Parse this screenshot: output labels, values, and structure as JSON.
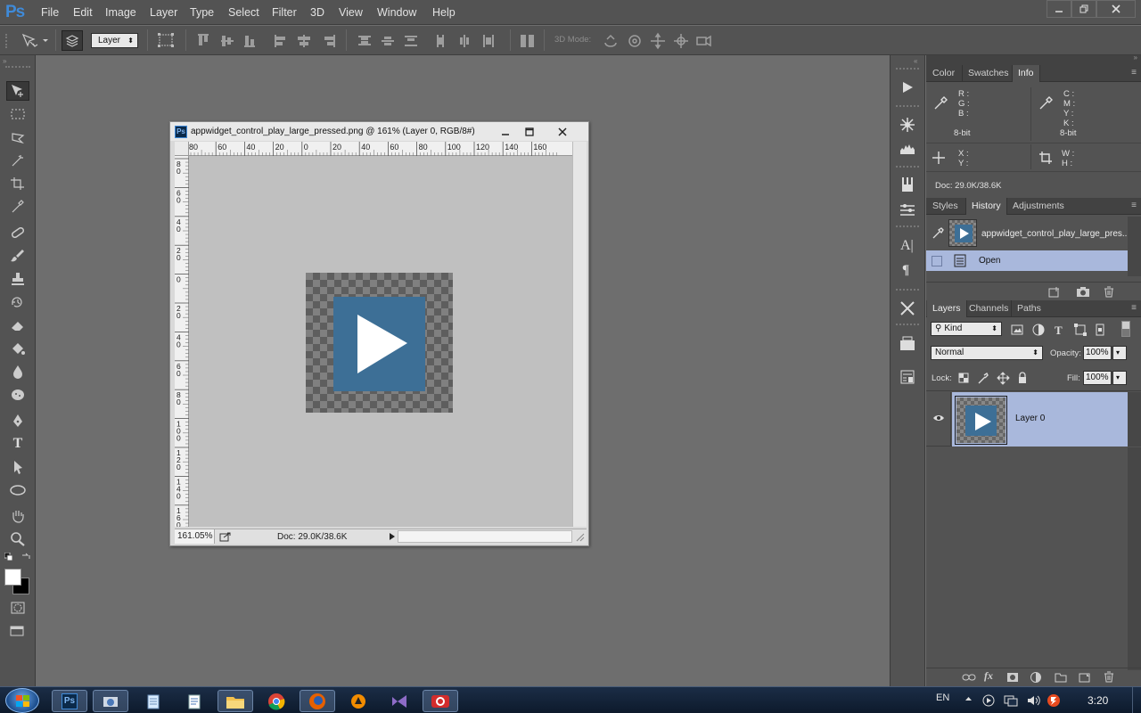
{
  "app": {
    "logo": "Ps"
  },
  "menu": [
    "File",
    "Edit",
    "Image",
    "Layer",
    "Type",
    "Select",
    "Filter",
    "3D",
    "View",
    "Window",
    "Help"
  ],
  "options_bar": {
    "auto_select_value": "Layer",
    "three_d_mode_label": "3D Mode:"
  },
  "document": {
    "title": "appwidget_control_play_large_pressed.png @ 161% (Layer 0, RGB/8#)",
    "ruler_top": [
      "80",
      "60",
      "40",
      "20",
      "0",
      "20",
      "40",
      "60",
      "80",
      "100",
      "120",
      "140",
      "160"
    ],
    "ruler_left": [
      "8\n0",
      "6\n0",
      "4\n0",
      "2\n0",
      "0",
      "2\n0",
      "4\n0",
      "6\n0",
      "8\n0",
      "1\n0\n0",
      "1\n2\n0",
      "1\n4\n0",
      "1\n6\n0"
    ],
    "zoom": "161.05%",
    "doc_size": "Doc: 29.0K/38.6K",
    "image_bg_color": "#3d6f96"
  },
  "info_panel": {
    "tabs": [
      "Color",
      "Swatches",
      "Info"
    ],
    "active_tab": "Info",
    "rgb_labels": [
      "R :",
      "G :",
      "B :"
    ],
    "cmyk_labels": [
      "C :",
      "M :",
      "Y :",
      "K :"
    ],
    "bit_left": "8-bit",
    "bit_right": "8-bit",
    "xy_labels": [
      "X :",
      "Y :"
    ],
    "wh_labels": [
      "W :",
      "H :"
    ],
    "doc_size": "Doc: 29.0K/38.6K"
  },
  "history_panel": {
    "tabs": [
      "Styles",
      "History",
      "Adjustments"
    ],
    "active_tab": "History",
    "snapshot_name": "appwidget_control_play_large_pres...",
    "states": [
      "Open"
    ]
  },
  "layers_panel": {
    "tabs": [
      "Layers",
      "Channels",
      "Paths"
    ],
    "active_tab": "Layers",
    "filter_kind": "Kind",
    "blend_mode": "Normal",
    "opacity_label": "Opacity:",
    "opacity_value": "100%",
    "lock_label": "Lock:",
    "fill_label": "Fill:",
    "fill_value": "100%",
    "layers": [
      {
        "name": "Layer 0",
        "visible": true,
        "selected": true
      }
    ]
  },
  "taskbar": {
    "language": "EN",
    "clock": "3:20"
  },
  "colors": {
    "selection_blue": "#a9b8dc",
    "ps_blue": "#3f8ad8"
  }
}
